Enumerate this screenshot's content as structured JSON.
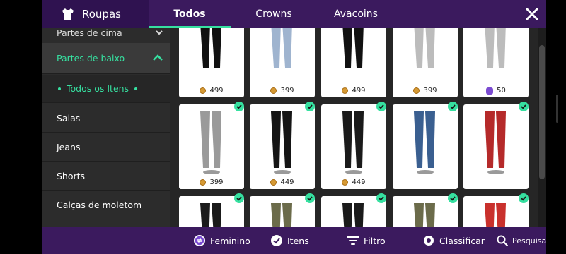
{
  "header": {
    "section_title": "Roupas",
    "tabs": [
      {
        "label": "Todos",
        "active": true
      },
      {
        "label": "Crowns",
        "active": false
      },
      {
        "label": "Avacoins",
        "active": false
      }
    ]
  },
  "sidebar": {
    "items": [
      {
        "label": "Partes de cima",
        "state": "partial"
      },
      {
        "label": "Partes de baixo",
        "state": "active"
      },
      {
        "label": "Todos os Itens",
        "state": "sub-selected"
      },
      {
        "label": "Saias",
        "state": "normal"
      },
      {
        "label": "Jeans",
        "state": "normal"
      },
      {
        "label": "Shorts",
        "state": "normal"
      },
      {
        "label": "Calças de moletom",
        "state": "normal"
      }
    ]
  },
  "grid": {
    "rows": [
      [
        {
          "price": "499",
          "currency": "coin",
          "owned": false
        },
        {
          "price": "399",
          "currency": "coin",
          "owned": false
        },
        {
          "price": "499",
          "currency": "coin",
          "owned": false
        },
        {
          "price": "399",
          "currency": "coin",
          "owned": false
        },
        {
          "price": "50",
          "currency": "gem",
          "owned": false
        }
      ],
      [
        {
          "price": "399",
          "currency": "coin",
          "owned": true
        },
        {
          "price": "449",
          "currency": "coin",
          "owned": true
        },
        {
          "price": "449",
          "currency": "coin",
          "owned": true
        },
        {
          "price": "",
          "currency": "",
          "owned": true
        },
        {
          "price": "",
          "currency": "",
          "owned": true
        }
      ],
      [
        {
          "price": "",
          "currency": "",
          "owned": true
        },
        {
          "price": "",
          "currency": "",
          "owned": true
        },
        {
          "price": "",
          "currency": "",
          "owned": true
        },
        {
          "price": "",
          "currency": "",
          "owned": true
        },
        {
          "price": "",
          "currency": "",
          "owned": true
        }
      ]
    ]
  },
  "bottombar": {
    "feminino": "Feminino",
    "itens": "Itens",
    "filtro": "Filtro",
    "classificar": "Classificar",
    "pesquisa": "Pesquisa"
  },
  "colors": {
    "accent": "#36e0a0",
    "header_bg": "#3b1a5e",
    "brand_bg": "#2f1250",
    "sidebar_bg": "#2c2c2c",
    "grid_bg": "#262626"
  }
}
